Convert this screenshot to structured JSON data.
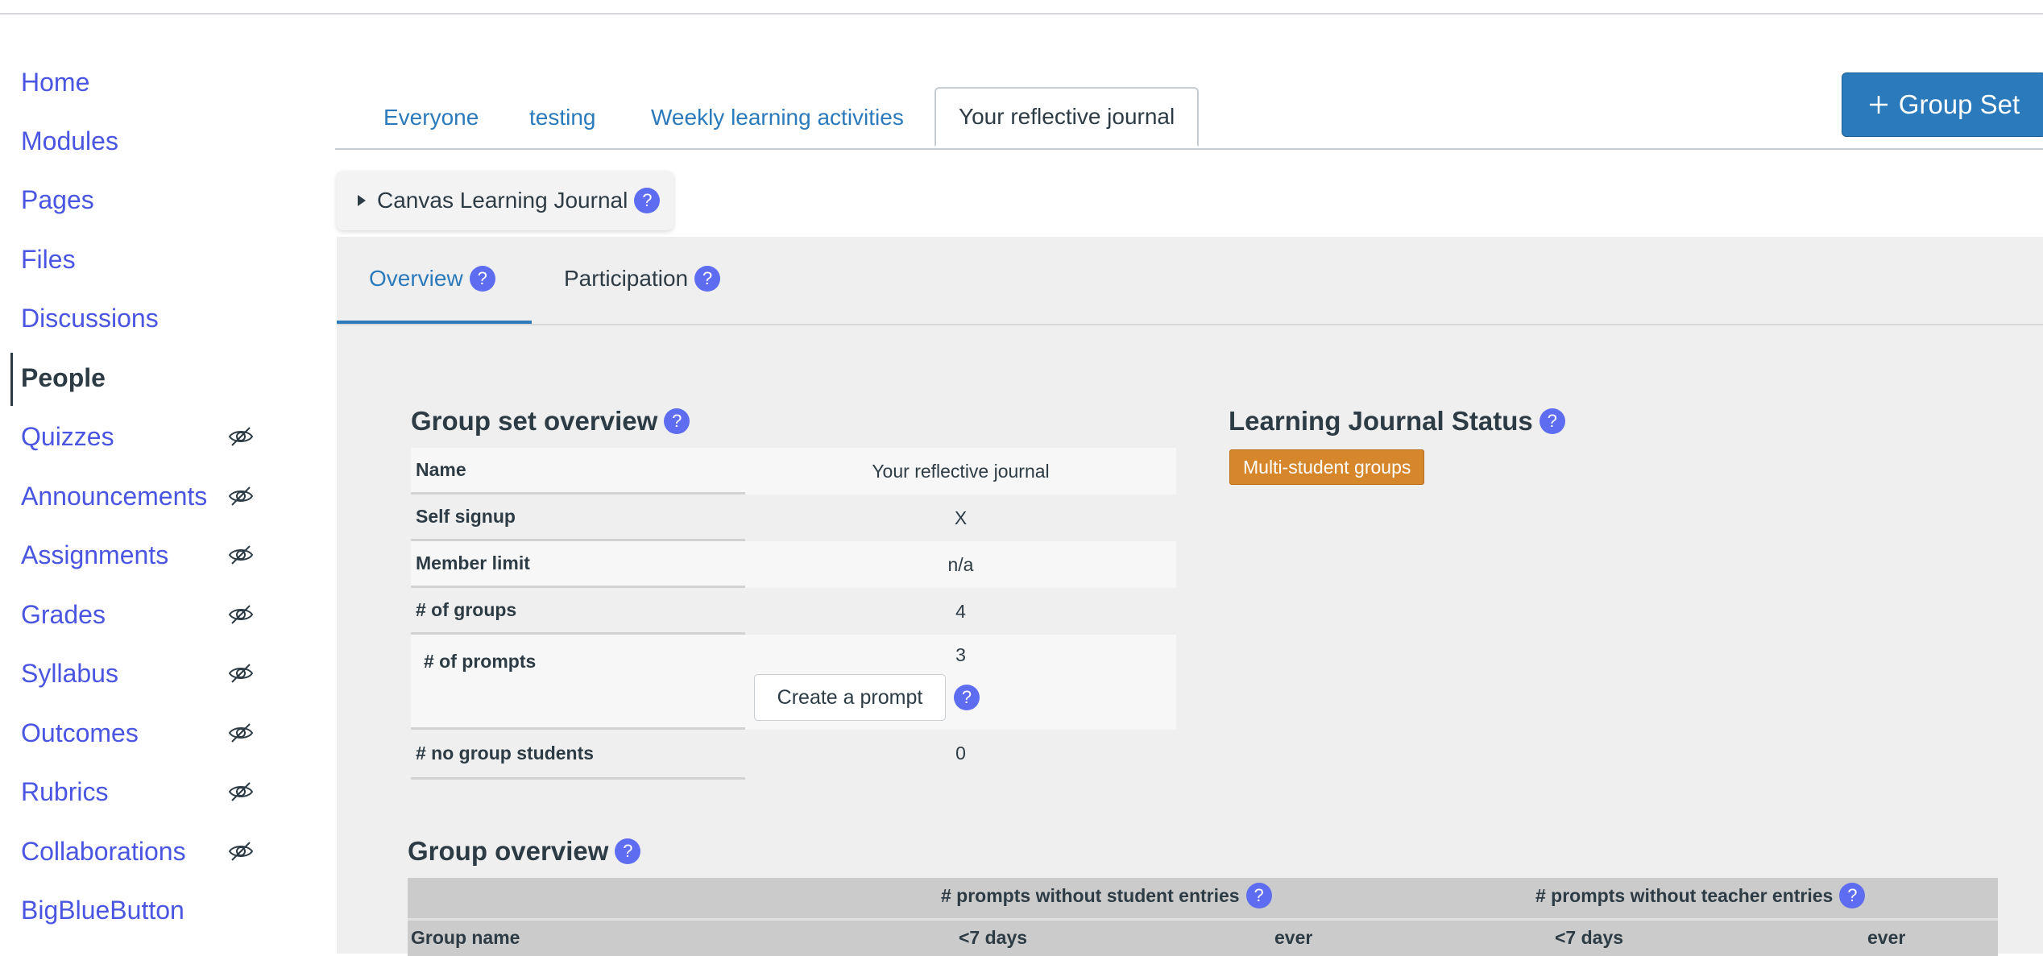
{
  "sidebar": {
    "items": [
      {
        "label": "Home",
        "hidden": false
      },
      {
        "label": "Modules",
        "hidden": false
      },
      {
        "label": "Pages",
        "hidden": false
      },
      {
        "label": "Files",
        "hidden": false
      },
      {
        "label": "Discussions",
        "hidden": false
      },
      {
        "label": "People",
        "hidden": false,
        "active": true
      },
      {
        "label": "Quizzes",
        "hidden": true
      },
      {
        "label": "Announcements",
        "hidden": true
      },
      {
        "label": "Assignments",
        "hidden": true
      },
      {
        "label": "Grades",
        "hidden": true
      },
      {
        "label": "Syllabus",
        "hidden": true
      },
      {
        "label": "Outcomes",
        "hidden": true
      },
      {
        "label": "Rubrics",
        "hidden": true
      },
      {
        "label": "Collaborations",
        "hidden": true
      },
      {
        "label": "BigBlueButton",
        "hidden": false
      }
    ]
  },
  "tabs": {
    "items": [
      "Everyone",
      "testing",
      "Weekly learning activities",
      "Your reflective journal"
    ],
    "active": "Your reflective journal"
  },
  "group_set_button": {
    "icon": "plus-icon",
    "label": "Group Set"
  },
  "journal": {
    "title": "Canvas Learning Journal",
    "subtabs": [
      "Overview",
      "Participation"
    ],
    "active_subtab": "Overview",
    "group_set_overview": {
      "heading": "Group set overview",
      "rows": [
        {
          "key": "Name",
          "value": "Your reflective journal"
        },
        {
          "key": "Self signup",
          "value": "X"
        },
        {
          "key": "Member limit",
          "value": "n/a"
        },
        {
          "key": "# of groups",
          "value": "4"
        },
        {
          "key": "# of prompts",
          "value": "3"
        },
        {
          "key": "# no group students",
          "value": "0"
        }
      ],
      "create_prompt_label": "Create a prompt"
    },
    "status": {
      "heading": "Learning Journal Status",
      "badge": "Multi-student groups",
      "badge_color": "#d6872c"
    },
    "group_overview": {
      "heading": "Group overview",
      "header_groups": [
        "# prompts without student entries",
        "# prompts without teacher entries"
      ],
      "columns": [
        "Group name",
        "<7 days",
        "ever",
        "<7 days",
        "ever"
      ]
    }
  },
  "colors": {
    "link": "#4a55e1",
    "primary": "#2b7abc",
    "help_icon": "#5d6cf0",
    "panel_bg": "#efefef"
  }
}
